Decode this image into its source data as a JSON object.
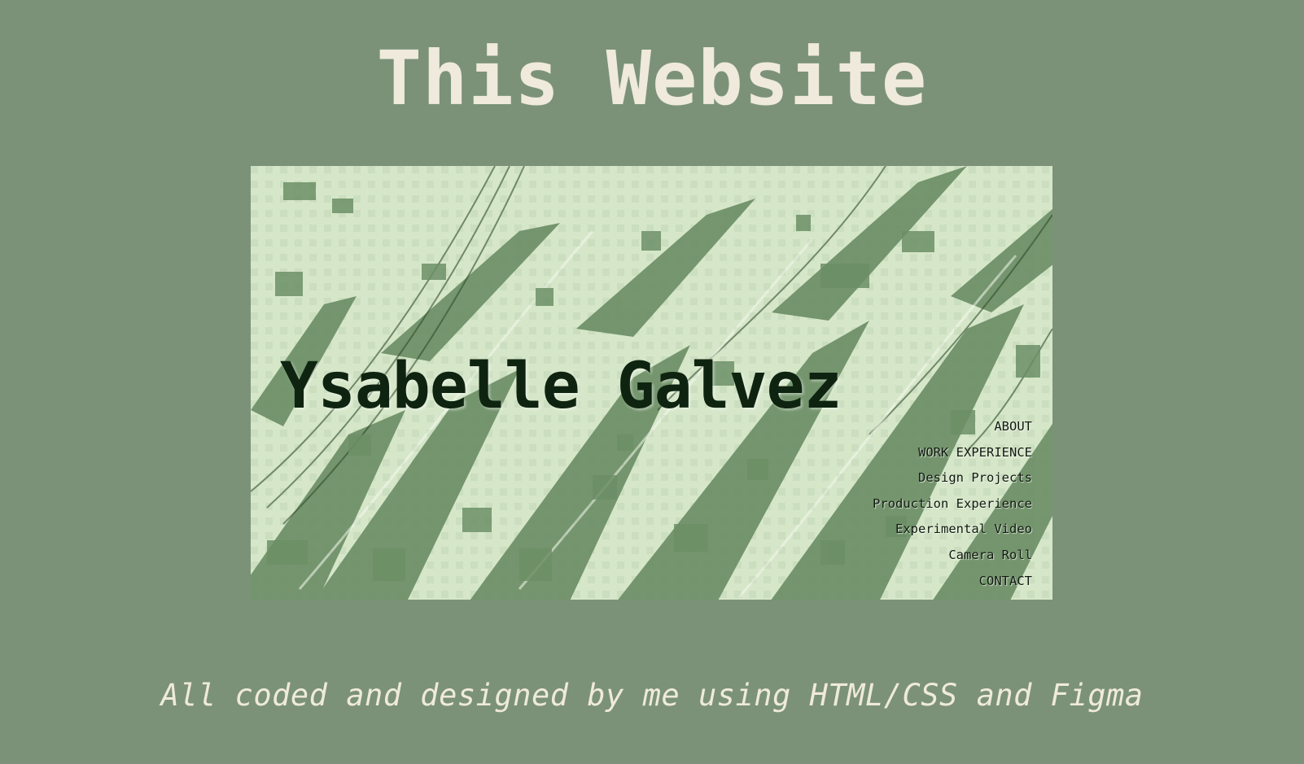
{
  "page": {
    "title": "This Website",
    "caption": "All coded and designed by me using HTML/CSS and Figma",
    "colors": {
      "background": "#7b9278",
      "heading_text": "#efeadb",
      "preview_light": "#d6e7c9",
      "preview_dark": "#6c8f66"
    }
  },
  "preview": {
    "site_name": "Ysabelle Galvez",
    "nav": [
      "ABOUT",
      "WORK EXPERIENCE",
      "Design Projects",
      "Production Experience",
      "Experimental Video",
      "Camera Roll",
      "CONTACT"
    ]
  }
}
